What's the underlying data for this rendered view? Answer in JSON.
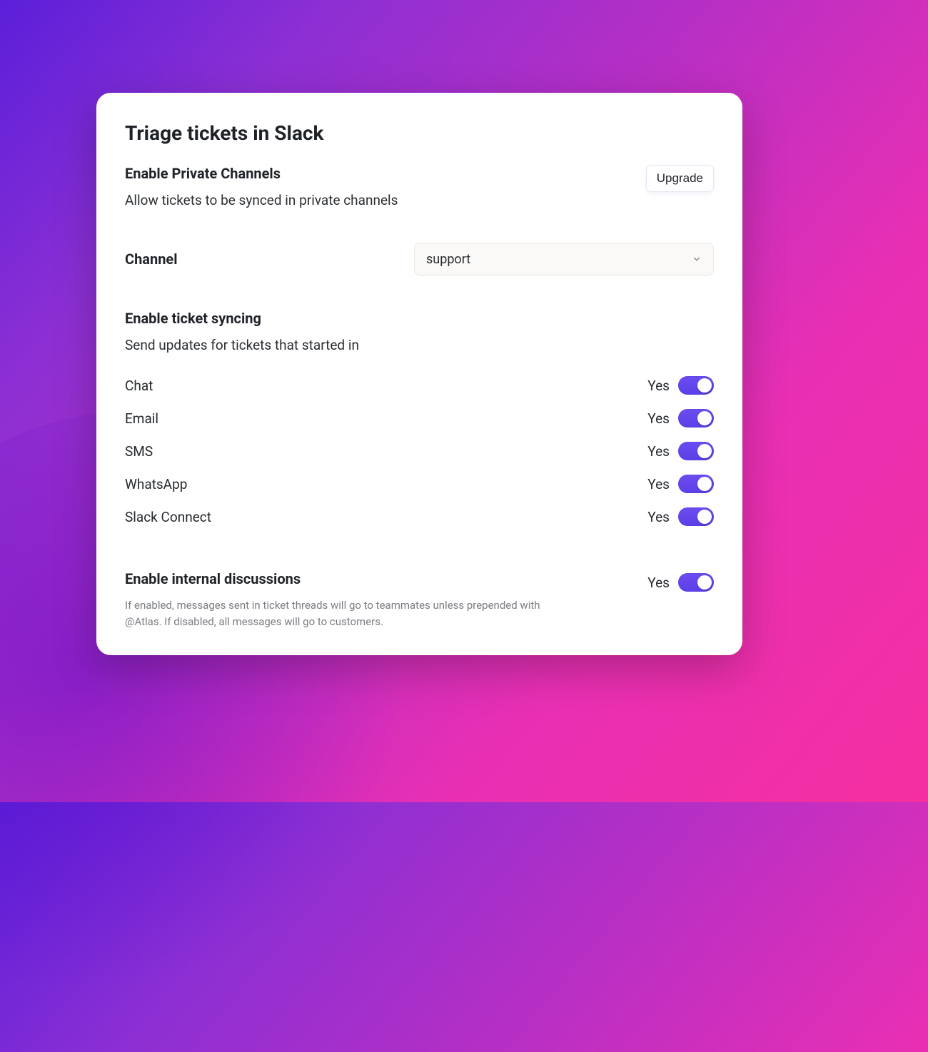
{
  "title": "Triage tickets in Slack",
  "privateChannels": {
    "heading": "Enable Private Channels",
    "description": "Allow tickets to be synced in private channels",
    "upgradeLabel": "Upgrade"
  },
  "channel": {
    "label": "Channel",
    "selected": "support"
  },
  "ticketSyncing": {
    "heading": "Enable ticket syncing",
    "description": "Send updates for tickets that started in",
    "yesLabel": "Yes",
    "items": [
      {
        "label": "Chat",
        "state": "Yes"
      },
      {
        "label": "Email",
        "state": "Yes"
      },
      {
        "label": "SMS",
        "state": "Yes"
      },
      {
        "label": "WhatsApp",
        "state": "Yes"
      },
      {
        "label": "Slack Connect",
        "state": "Yes"
      }
    ]
  },
  "internalDiscussions": {
    "heading": "Enable internal discussions",
    "help": "If enabled, messages sent in ticket threads will go to teammates unless prepended with @Atlas. If disabled, all messages will go to customers.",
    "state": "Yes"
  },
  "colors": {
    "toggleAccent": "#5d3fe8"
  }
}
